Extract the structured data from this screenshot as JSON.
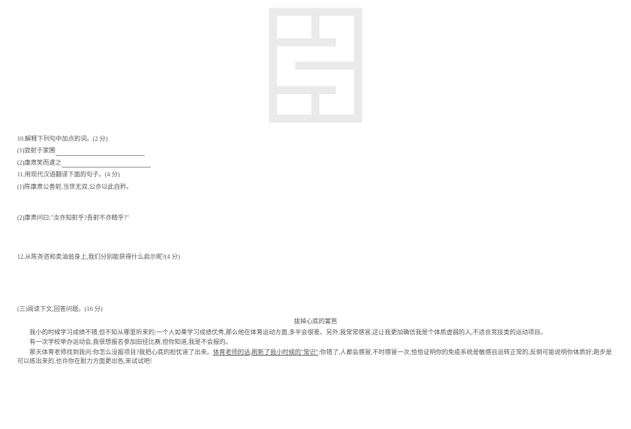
{
  "q10": {
    "stem": "10.解释下列句中加点的词。(2 分)",
    "items": [
      "(1)尝射于家圃",
      "(2)康肃笑而遣之"
    ]
  },
  "q11": {
    "stem": "11.用现代汉语翻译下面的句子。(4 分)",
    "items": [
      "(1)陈康肃公善射,当世无双,公亦以此自矜。",
      "(2)康肃问曰:\"汝亦知射乎?吾射不亦精乎?\""
    ]
  },
  "q12": {
    "stem": "12.从陈尧咨和卖油翁身上,我们分别能获得什么启示呢?(4 分)"
  },
  "section3": {
    "label": "(三)阅读下文,回答问题。(16 分)",
    "title": "拔掉心底的篱笆",
    "paragraphs": [
      {
        "text": "我小的时候学习成绩不错,但不知从哪里听来的:一个人如果学习成绩优秀,那么他在体育运动方面,多半会很差。另外,我常常感冒,这让我更加确信我是个体质虚弱的人,不适合竞技类的运动项目。"
      },
      {
        "text": "有一次学校举办运动会,我很想报名参加田径比赛,但你知道,我是不会报的。"
      },
      {
        "prefix": "那天体育老师找到我问:你怎么没报项目?我把心底的担忧道了出来。",
        "underlined": "体育老师的话,刷新了我小时候的\"常识\"",
        "suffix": ":你错了,人都会感冒,不时感冒一次,恰恰证明你的免疫系统是敏感且运转正常的,反倒可能说明你体质好;跑步是可以练出来的,也许你在耐力方面更出色,来试试吧!"
      }
    ]
  }
}
